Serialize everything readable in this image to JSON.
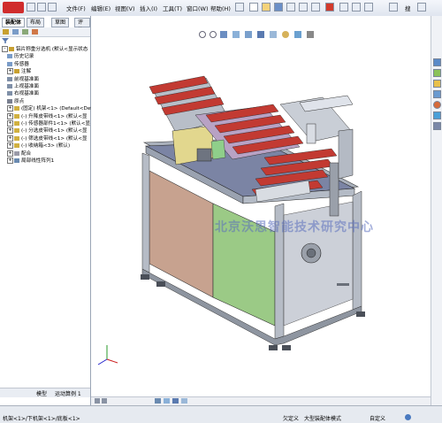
{
  "menu": {
    "items": [
      "文件(F)",
      "编辑(E)",
      "视图(V)",
      "插入(I)",
      "工具(T)",
      "窗口(W)",
      "帮助(H)"
    ],
    "right_text": "搜"
  },
  "panel": {
    "tabs": [
      "装配体",
      "布局",
      "草图",
      "评估"
    ],
    "tree": [
      {
        "label": "铝片称重分选机 (默认<显示状态-1>)",
        "icon_color": "#c8a030",
        "indent": 0,
        "exp": "-"
      },
      {
        "label": "历史记录",
        "icon_color": "#7a9cc8",
        "indent": 1,
        "exp": ""
      },
      {
        "label": "传感器",
        "icon_color": "#7a9cc8",
        "indent": 1,
        "exp": ""
      },
      {
        "label": "注解",
        "icon_color": "#c8a030",
        "indent": 1,
        "exp": "+"
      },
      {
        "label": "前视基准面",
        "icon_color": "#8090a8",
        "indent": 1,
        "exp": ""
      },
      {
        "label": "上视基准面",
        "icon_color": "#8090a8",
        "indent": 1,
        "exp": ""
      },
      {
        "label": "右视基准面",
        "icon_color": "#8090a8",
        "indent": 1,
        "exp": ""
      },
      {
        "label": "原点",
        "icon_color": "#7a8090",
        "indent": 1,
        "exp": ""
      },
      {
        "label": "(固定) 机架<1> (Default<Defa",
        "icon_color": "#d0b040",
        "indent": 1,
        "exp": "+"
      },
      {
        "label": "(-) 升降皮带线<1> (默认<显",
        "icon_color": "#d0b040",
        "indent": 1,
        "exp": "+"
      },
      {
        "label": "(-) 传感器部件1<1> (默认<显",
        "icon_color": "#d0b040",
        "indent": 1,
        "exp": "+"
      },
      {
        "label": "(-) 分选皮带线<1> (默认<显",
        "icon_color": "#d0b040",
        "indent": 1,
        "exp": "+"
      },
      {
        "label": "(-) 筛选皮带线<1> (默认<显",
        "icon_color": "#d0b040",
        "indent": 1,
        "exp": "+"
      },
      {
        "label": "(-) 收纳箱<3> (默认)",
        "icon_color": "#d0b040",
        "indent": 1,
        "exp": "+"
      },
      {
        "label": "配合",
        "icon_color": "#9a9aa8",
        "indent": 1,
        "exp": "+"
      },
      {
        "label": "局部线性阵列1",
        "icon_color": "#6a8ab0",
        "indent": 1,
        "exp": "+"
      }
    ],
    "bottom_tabs": [
      "模型",
      "运动算例 1"
    ]
  },
  "viewport": {
    "watermark": "北京沃思智能技术研究中心"
  },
  "status": {
    "breadcrumb": "机架<1>/下机架<1>/底板<1>",
    "state": "欠定义",
    "mode": "大型装配体模式",
    "custom": "自定义"
  },
  "colors": {
    "frame": "#a9b0bb",
    "tabletop": "#7b84a4",
    "door_left": "#c7a28f",
    "door_right": "#9bca86",
    "belt_red": "#c23a32",
    "accent_blue": "#2f5fa8"
  }
}
